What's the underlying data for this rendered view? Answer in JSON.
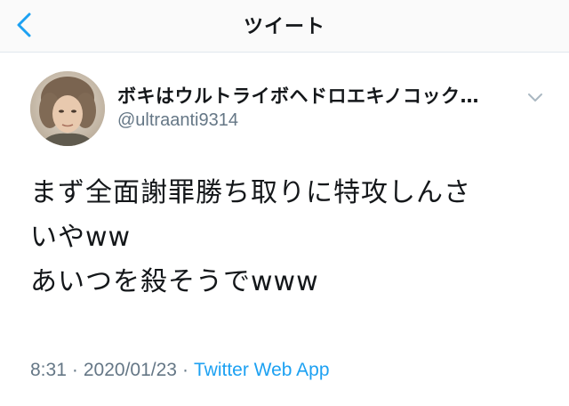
{
  "navbar": {
    "title": "ツイート",
    "back_icon": "chevron-left-icon",
    "accent_color": "#1da1f2"
  },
  "tweet": {
    "author": {
      "display_name": "ボキはウルトライボヘドロエキノコック…",
      "handle": "@ultraanti9314"
    },
    "menu_icon": "chevron-down-icon",
    "text_lines": [
      "まず全面謝罪勝ち取りに特攻しんさ",
      "いやww",
      "あいつを殺そうでwww"
    ],
    "meta": {
      "time": "8:31",
      "date": "2020/01/23",
      "separator": "·",
      "source": "Twitter Web App"
    }
  }
}
